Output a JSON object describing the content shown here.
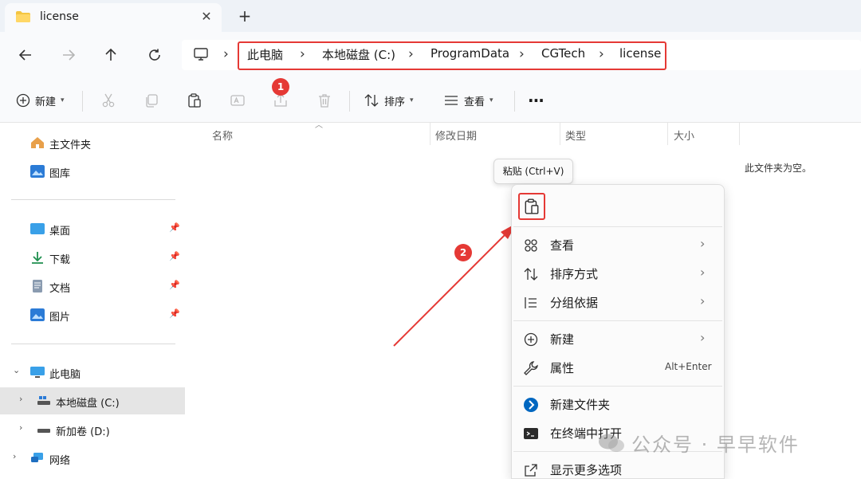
{
  "tab": {
    "title": "license",
    "close_glyph": "✕",
    "new_tab_glyph": "+"
  },
  "nav": {
    "back_icon": "arrow-left-icon",
    "forward_icon": "arrow-right-icon",
    "up_icon": "arrow-up-icon",
    "refresh_icon": "refresh-icon",
    "breadcrumb": [
      "此电脑",
      "本地磁盘 (C:)",
      "ProgramData",
      "CGTech",
      "license"
    ]
  },
  "toolbar": {
    "new_label": "新建",
    "sort_label": "排序",
    "view_label": "查看",
    "more_label": "···",
    "badge1": "1",
    "badge2": "2"
  },
  "sidebar": {
    "home": "主文件夹",
    "gallery": "图库",
    "desktop": "桌面",
    "downloads": "下载",
    "documents": "文档",
    "pictures": "图片",
    "this_pc": "此电脑",
    "local_disk": "本地磁盘 (C:)",
    "new_volume": "新加卷 (D:)",
    "network": "网络"
  },
  "columns": {
    "name": "名称",
    "modified": "修改日期",
    "type": "类型",
    "size": "大小"
  },
  "empty_message": "此文件夹为空。",
  "tooltip": "粘贴 (Ctrl+V)",
  "context_menu": {
    "view": "查看",
    "sort_by": "排序方式",
    "group_by": "分组依据",
    "new": "新建",
    "properties": "属性",
    "properties_accel": "Alt+Enter",
    "new_folder": "新建文件夹",
    "open_terminal": "在终端中打开",
    "more_options": "显示更多选项"
  },
  "watermark": "公众号 · 早早软件",
  "colors": {
    "highlight_red": "#e53935",
    "accent_blue": "#0067c0",
    "folder_yellow": "#f4c542"
  }
}
